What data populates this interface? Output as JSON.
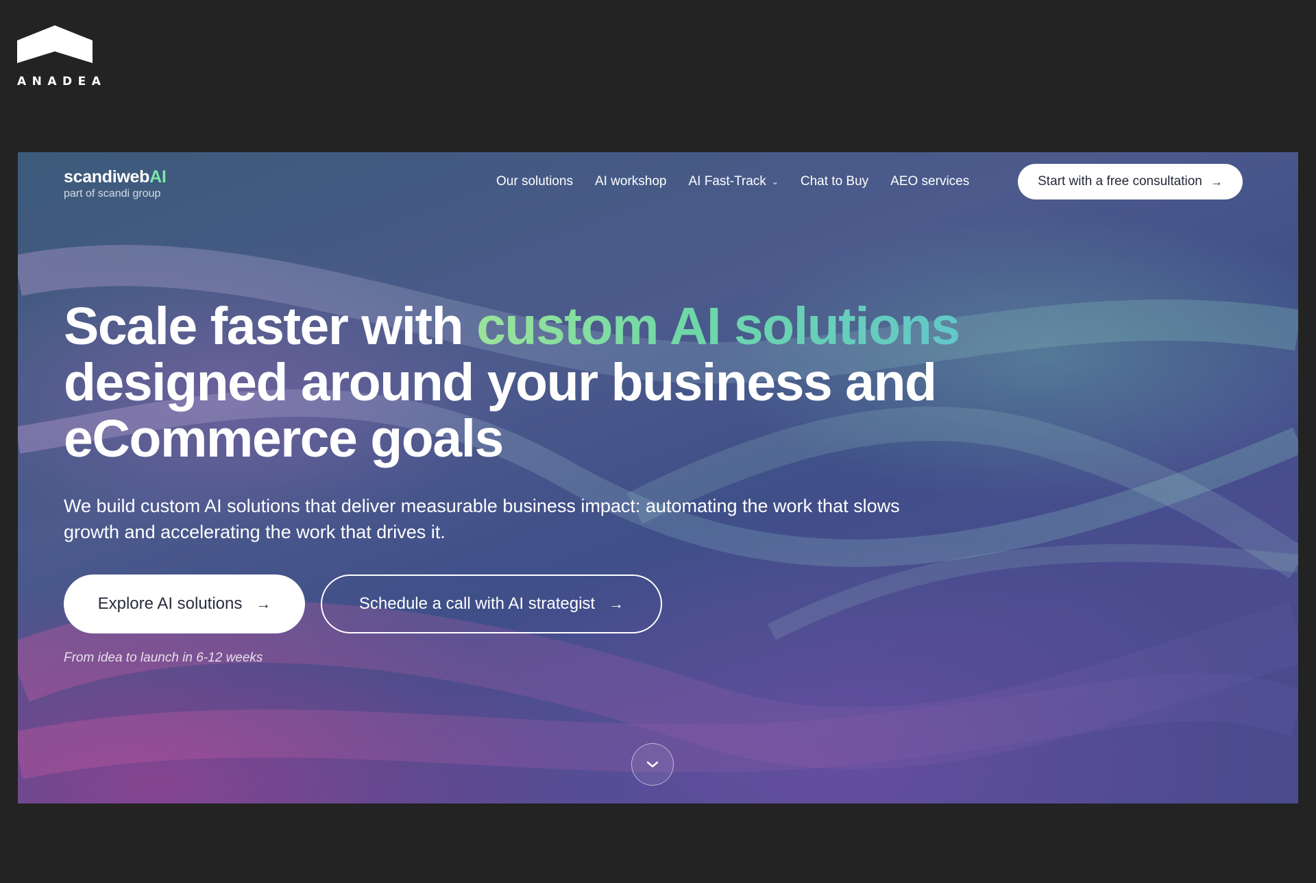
{
  "outer": {
    "logo_text": "ANADEA"
  },
  "nav": {
    "brand_main": "scandiweb",
    "brand_ai": "AI",
    "brand_sub": "part of scandi group",
    "links": [
      {
        "label": "Our solutions"
      },
      {
        "label": "AI workshop"
      },
      {
        "label": "AI Fast-Track",
        "has_dropdown": true
      },
      {
        "label": "Chat to Buy"
      },
      {
        "label": "AEO services"
      }
    ],
    "cta_label": "Start with a free consultation"
  },
  "hero": {
    "title_part1": "Scale faster with ",
    "title_accent": "custom AI solutions",
    "title_part2": "designed around your business and eCommerce goals",
    "subtitle": "We build custom AI solutions that deliver measurable business impact: automating the work that slows growth and accelerating the work that drives it.",
    "primary_button": "Explore AI solutions",
    "secondary_button": "Schedule a call with AI strategist",
    "note": "From idea to launch in 6-12 weeks"
  },
  "colors": {
    "page_background": "#232323",
    "accent_green": "#7be6a8",
    "accent_teal": "#62c7c9",
    "button_white": "#ffffff"
  },
  "icons": {
    "arrow": "arrow-right-icon",
    "chevron": "chevron-down-icon",
    "scroll": "chevron-down-icon"
  }
}
